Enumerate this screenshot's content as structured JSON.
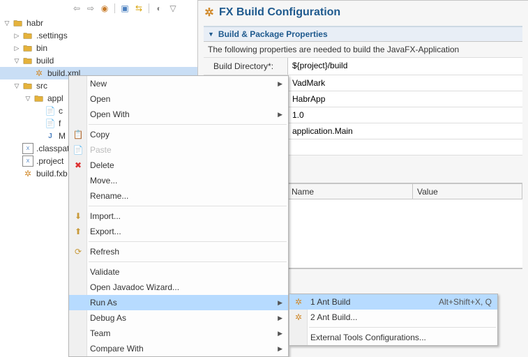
{
  "tree": {
    "root": "habr",
    "items": {
      "settings": ".settings",
      "bin": "bin",
      "build": "build",
      "buildxml": "build.xml",
      "src": "src",
      "appl": "appl",
      "c_partial": "c",
      "f_partial": "f",
      "m_partial": "M",
      "classpath": ".classpat",
      "project": ".project",
      "buildfxb": "build.fxb"
    }
  },
  "config": {
    "title": "FX Build Configuration",
    "section_title": "Build & Package Properties",
    "section_desc": "The following properties are needed to build the JavaFX-Application",
    "fields": [
      {
        "label": "Build Directory*:",
        "value": "${project}/build"
      },
      {
        "label": "",
        "value": "VadMark"
      },
      {
        "label": "",
        "value": "HabrApp"
      },
      {
        "label": "",
        "value": "1.0"
      },
      {
        "label": "",
        "value": "application.Main"
      }
    ],
    "kv": {
      "name_header": "Name",
      "value_header": "Value"
    }
  },
  "menu": {
    "new": "New",
    "open": "Open",
    "open_with": "Open With",
    "copy": "Copy",
    "paste": "Paste",
    "delete": "Delete",
    "move": "Move...",
    "rename": "Rename...",
    "import": "Import...",
    "export": "Export...",
    "refresh": "Refresh",
    "validate": "Validate",
    "javadoc": "Open Javadoc Wizard...",
    "run_as": "Run As",
    "debug_as": "Debug As",
    "team": "Team",
    "compare_with": "Compare With"
  },
  "submenu": {
    "ant1": "1 Ant Build",
    "ant1_key": "Alt+Shift+X, Q",
    "ant2": "2 Ant Build...",
    "external": "External Tools Configurations..."
  }
}
